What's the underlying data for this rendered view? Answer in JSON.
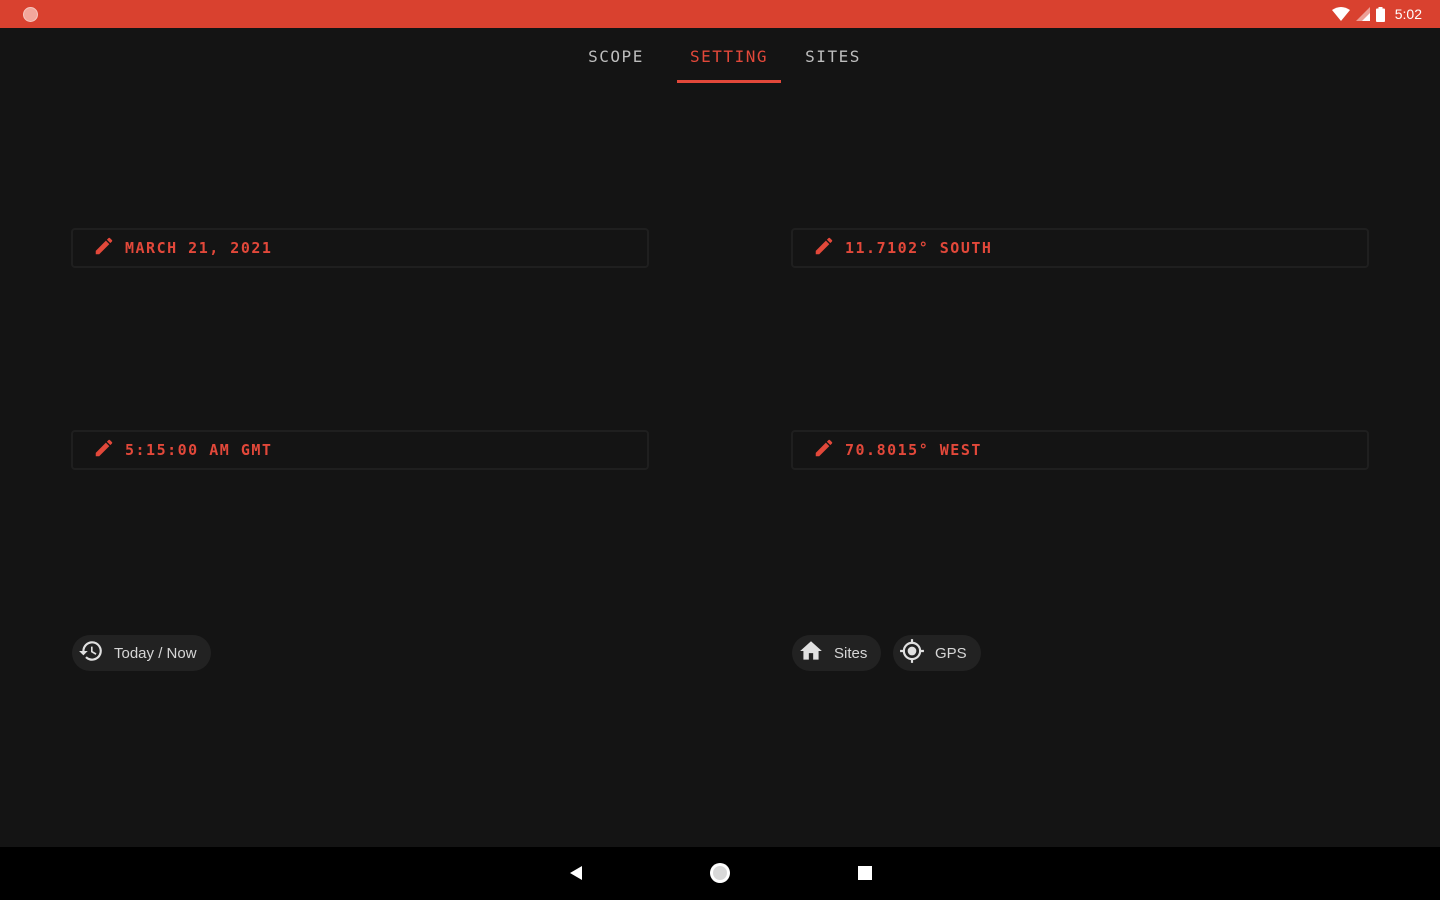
{
  "status": {
    "time": "5:02",
    "icons": [
      "app-icon",
      "wifi-icon",
      "signal-icon",
      "battery-icon"
    ]
  },
  "tabs": [
    {
      "label": "SCOPE",
      "active": false
    },
    {
      "label": "SETTING",
      "active": true
    },
    {
      "label": "SITES",
      "active": false
    }
  ],
  "setting": {
    "date": {
      "icon": "pencil-icon",
      "value": "MARCH 21, 2021"
    },
    "time": {
      "icon": "pencil-icon",
      "value": "5:15:00 AM GMT"
    },
    "latitude": {
      "icon": "pencil-icon",
      "value": "11.7102° SOUTH"
    },
    "longitude": {
      "icon": "pencil-icon",
      "value": "70.8015° WEST"
    },
    "today_button": {
      "icon": "history-icon",
      "label": "Today / Now"
    },
    "sites_button": {
      "icon": "home-icon",
      "label": "Sites"
    },
    "gps_button": {
      "icon": "gps-icon",
      "label": "GPS"
    }
  },
  "navigation": [
    "back-icon",
    "home-circle-icon",
    "recents-icon"
  ],
  "colors": {
    "accent": "#e2483a",
    "statusbar": "#d9412f",
    "background": "#141414"
  }
}
